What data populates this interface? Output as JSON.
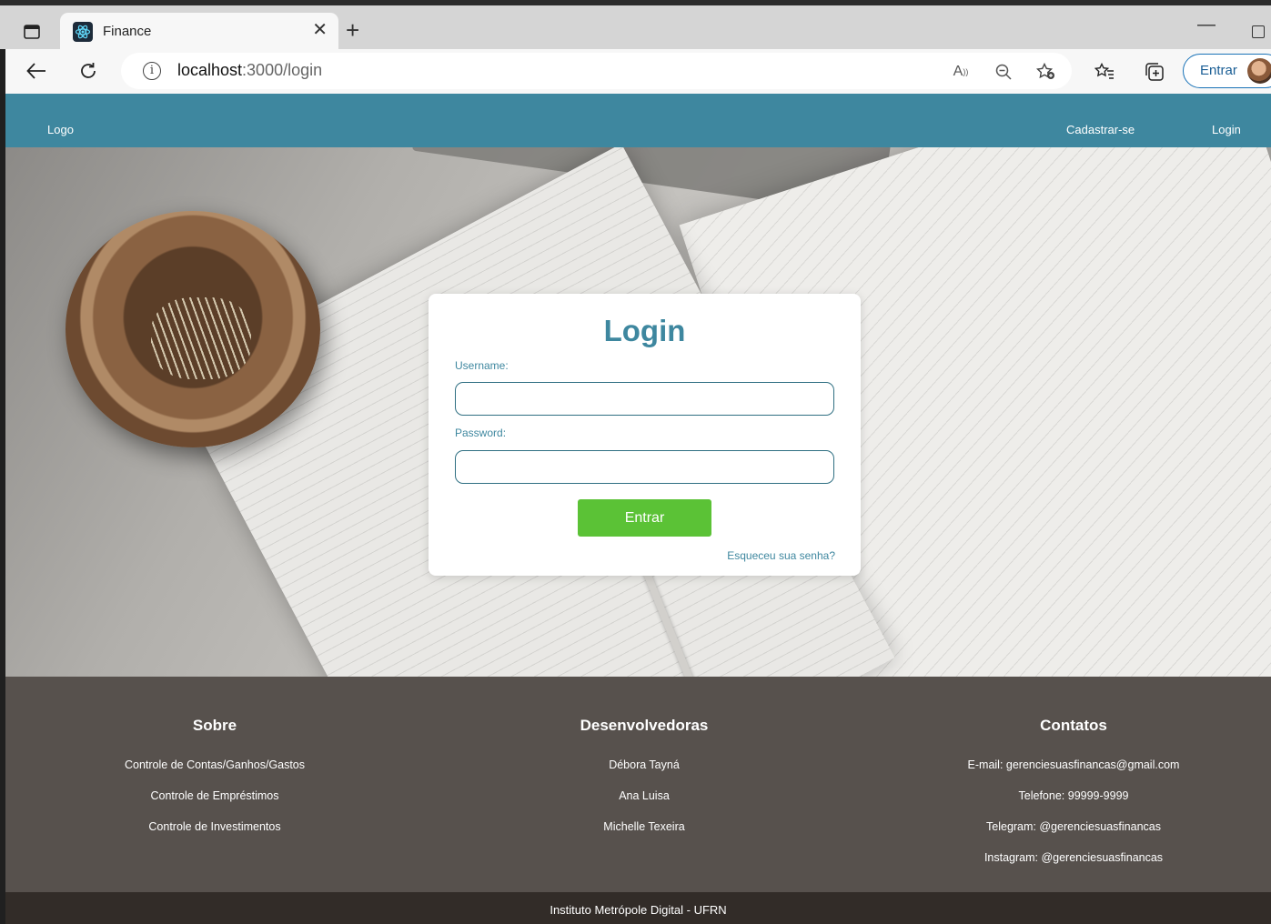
{
  "browser": {
    "tab_title": "Finance",
    "url_host": "localhost",
    "url_path": ":3000/login",
    "profile_label": "Entrar"
  },
  "header": {
    "logo": "Logo",
    "nav_register": "Cadastrar-se",
    "nav_login": "Login"
  },
  "login": {
    "title": "Login",
    "username_label": "Username:",
    "username_value": "",
    "password_label": "Password:",
    "password_value": "",
    "submit_label": "Entrar",
    "forgot_link": "Esqueceu sua senha?"
  },
  "footer": {
    "about": {
      "title": "Sobre",
      "items": [
        "Controle de Contas/Ganhos/Gastos",
        "Controle de Empréstimos",
        "Controle de Investimentos"
      ]
    },
    "developers": {
      "title": "Desenvolvedoras",
      "items": [
        "Débora Tayná",
        "Ana Luisa",
        "Michelle Texeira"
      ]
    },
    "contacts": {
      "title": "Contatos",
      "items": [
        "E-mail: gerenciesuasfinancas@gmail.com",
        "Telefone: 99999-9999",
        "Telegram: @gerenciesuasfinancas",
        "Instagram: @gerenciesuasfinancas"
      ]
    },
    "bottom": "Instituto Metrópole Digital - UFRN"
  },
  "colors": {
    "brand": "#3e879f",
    "button": "#5bc236",
    "footer": "#57514d",
    "footer_bottom": "#322c28"
  },
  "icons": [
    "tab-actions-icon",
    "react-favicon-icon",
    "close-icon",
    "plus-icon",
    "back-arrow-icon",
    "reload-icon",
    "info-icon",
    "read-aloud-icon",
    "zoom-out-icon",
    "favorite-add-icon",
    "favorites-icon",
    "collections-icon"
  ]
}
